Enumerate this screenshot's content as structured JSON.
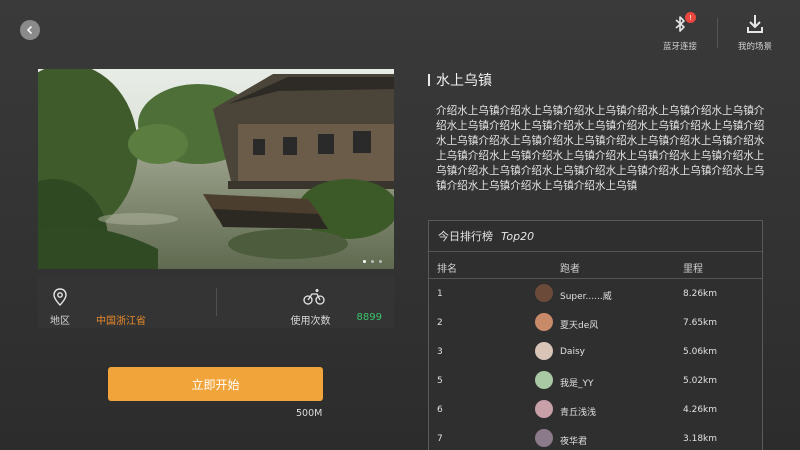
{
  "topbar": {
    "back_icon": "chevron-left-icon",
    "bluetooth": {
      "label": "蓝牙连接",
      "badge": "!",
      "icon": "bluetooth-icon"
    },
    "my_scenes": {
      "label": "我的场景",
      "icon": "download-icon"
    }
  },
  "scene": {
    "title": "水上乌镇",
    "description": "介绍水上乌镇介绍水上乌镇介绍水上乌镇介绍水上乌镇介绍水上乌镇介绍水上乌镇介绍水上乌镇介绍水上乌镇介绍水上乌镇介绍水上乌镇介绍水上乌镇介绍水上乌镇介绍水上乌镇介绍水上乌镇介绍水上乌镇介绍水上乌镇介绍水上乌镇介绍水上乌镇介绍水上乌镇介绍水上乌镇介绍水上乌镇介绍水上乌镇介绍水上乌镇介绍水上乌镇介绍水上乌镇介绍水上乌镇介绍水上乌镇介绍水上乌镇介绍水上乌镇",
    "region_label": "地区",
    "region_value": "中国浙江省",
    "usage_label": "使用次数",
    "usage_value": "8899",
    "start_label": "立即开始",
    "size": "500M"
  },
  "ranking": {
    "title": "今日排行榜",
    "subtitle": "Top20",
    "col_rank": "排名",
    "col_runner": "跑者",
    "col_distance": "里程",
    "rows": [
      {
        "rank": "1",
        "name": "Super......威",
        "distance": "8.26km",
        "avatar_color": "#6b4a3a"
      },
      {
        "rank": "2",
        "name": "夏天de风",
        "distance": "7.65km",
        "avatar_color": "#c98a6a"
      },
      {
        "rank": "3",
        "name": "Daisy",
        "distance": "5.06km",
        "avatar_color": "#d9c4b8"
      },
      {
        "rank": "5",
        "name": "我是_YY",
        "distance": "5.02km",
        "avatar_color": "#a9c9a4"
      },
      {
        "rank": "6",
        "name": "青丘浅浅",
        "distance": "4.26km",
        "avatar_color": "#c7a0a8"
      },
      {
        "rank": "7",
        "name": "夜华君",
        "distance": "3.18km",
        "avatar_color": "#8a7a8a"
      }
    ]
  }
}
